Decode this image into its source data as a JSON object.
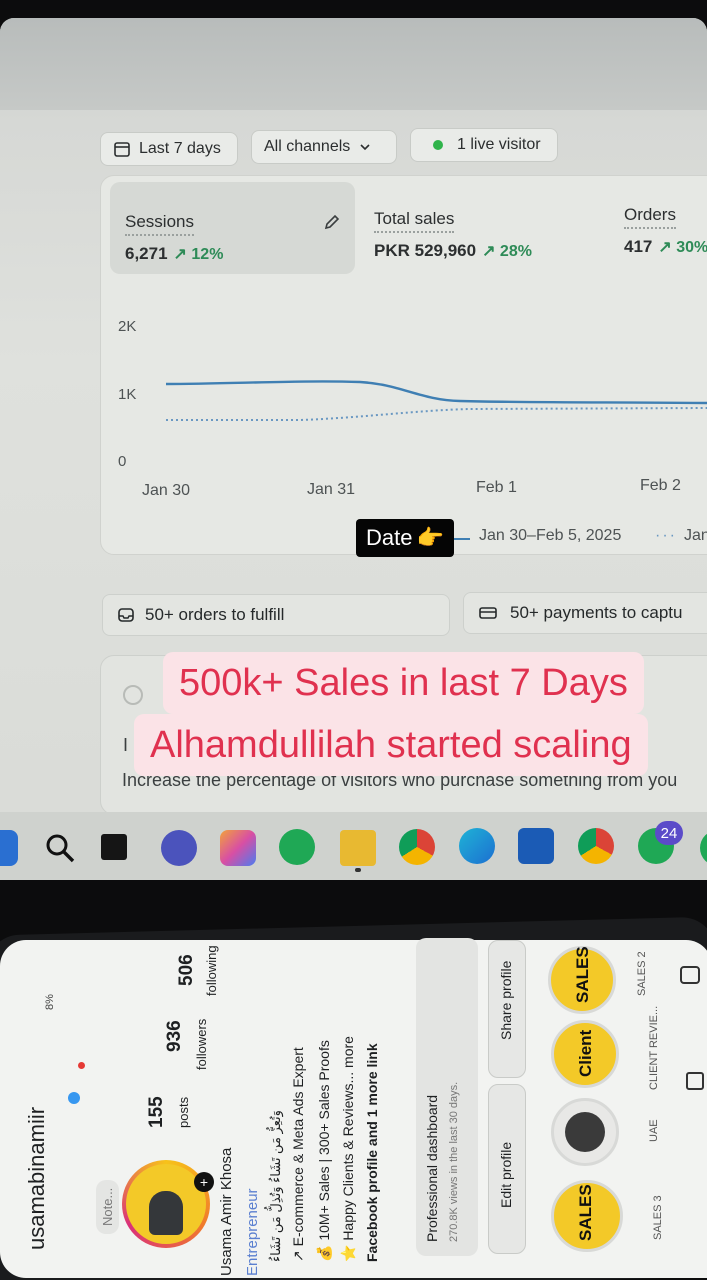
{
  "dashboard": {
    "filters": {
      "date_range": "Last 7 days",
      "channels": "All channels",
      "live_visitors": "1 live visitor"
    },
    "metrics": [
      {
        "label": "Sessions",
        "value": "6,271",
        "change": "↗ 12%"
      },
      {
        "label": "Total sales",
        "value": "PKR 529,960",
        "change": "↗ 28%"
      },
      {
        "label": "Orders",
        "value": "417",
        "change": "↗ 30%"
      }
    ],
    "chart": {
      "y_ticks": [
        "2K",
        "1K",
        "0"
      ],
      "x_ticks": [
        "Jan 30",
        "Jan 31",
        "Feb 1",
        "Feb 2"
      ],
      "legend_current": "Jan 30–Feb 5, 2025",
      "legend_previous": "Jan"
    },
    "tasks": {
      "orders": "50+ orders to fulfill",
      "payments": "50+ payments to captu"
    },
    "lower_card_text": "Increase the percentage of visitors who purchase something from you",
    "colors": {
      "accent_green": "#2e8b57",
      "line_blue": "#3f7fb3",
      "caption_red": "#e0314f"
    }
  },
  "overlay": {
    "date_sticker": "Date",
    "date_sticker_emoji": "👉",
    "caption_line1": "500k+ Sales in last 7 Days",
    "caption_line2": "Alhamdullilah started scaling"
  },
  "taskbar": {
    "badge_count": "24",
    "icons": [
      "start-icon",
      "search-icon",
      "task-view-icon",
      "teams-icon",
      "copilot-icon",
      "whatsapp-icon",
      "file-explorer-icon",
      "chrome-icon",
      "edge-icon",
      "store-icon",
      "chrome-profile-icon",
      "whatsapp-badge-icon"
    ]
  },
  "instagram": {
    "status_bar": "8%",
    "username": "usamabinamiir",
    "note": "Note...",
    "posts_count": "155",
    "posts_label": "posts",
    "followers_count": "936",
    "followers_label": "followers",
    "following_count": "506",
    "following_label": "following",
    "display_name": "Usama Amir Khosa",
    "category": "Entrepreneur",
    "bio_arabic": "وَتُعِزُّ مَن تَشَاءُ وَتُذِلُّ مَن تَشَاءُ",
    "bio_line1": "↗ E-commerce & Meta Ads Expert",
    "bio_line2": "💰 10M+ Sales | 300+ Sales Proofs",
    "bio_line3": "⭐ Happy Clients & Reviews... more",
    "bio_link": "Facebook profile and 1 more link",
    "pro_dashboard_title": "Professional dashboard",
    "pro_dashboard_sub": "270.8K views in the last 30 days.",
    "edit_profile": "Edit profile",
    "share_profile": "Share profile",
    "highlights": [
      {
        "cover": "SALES",
        "label": "SALES 3"
      },
      {
        "cover": "",
        "label": "UAE"
      },
      {
        "cover": "Client",
        "label": "CLIENT REVIE..."
      },
      {
        "cover": "SALES",
        "label": "SALES 2"
      }
    ]
  }
}
